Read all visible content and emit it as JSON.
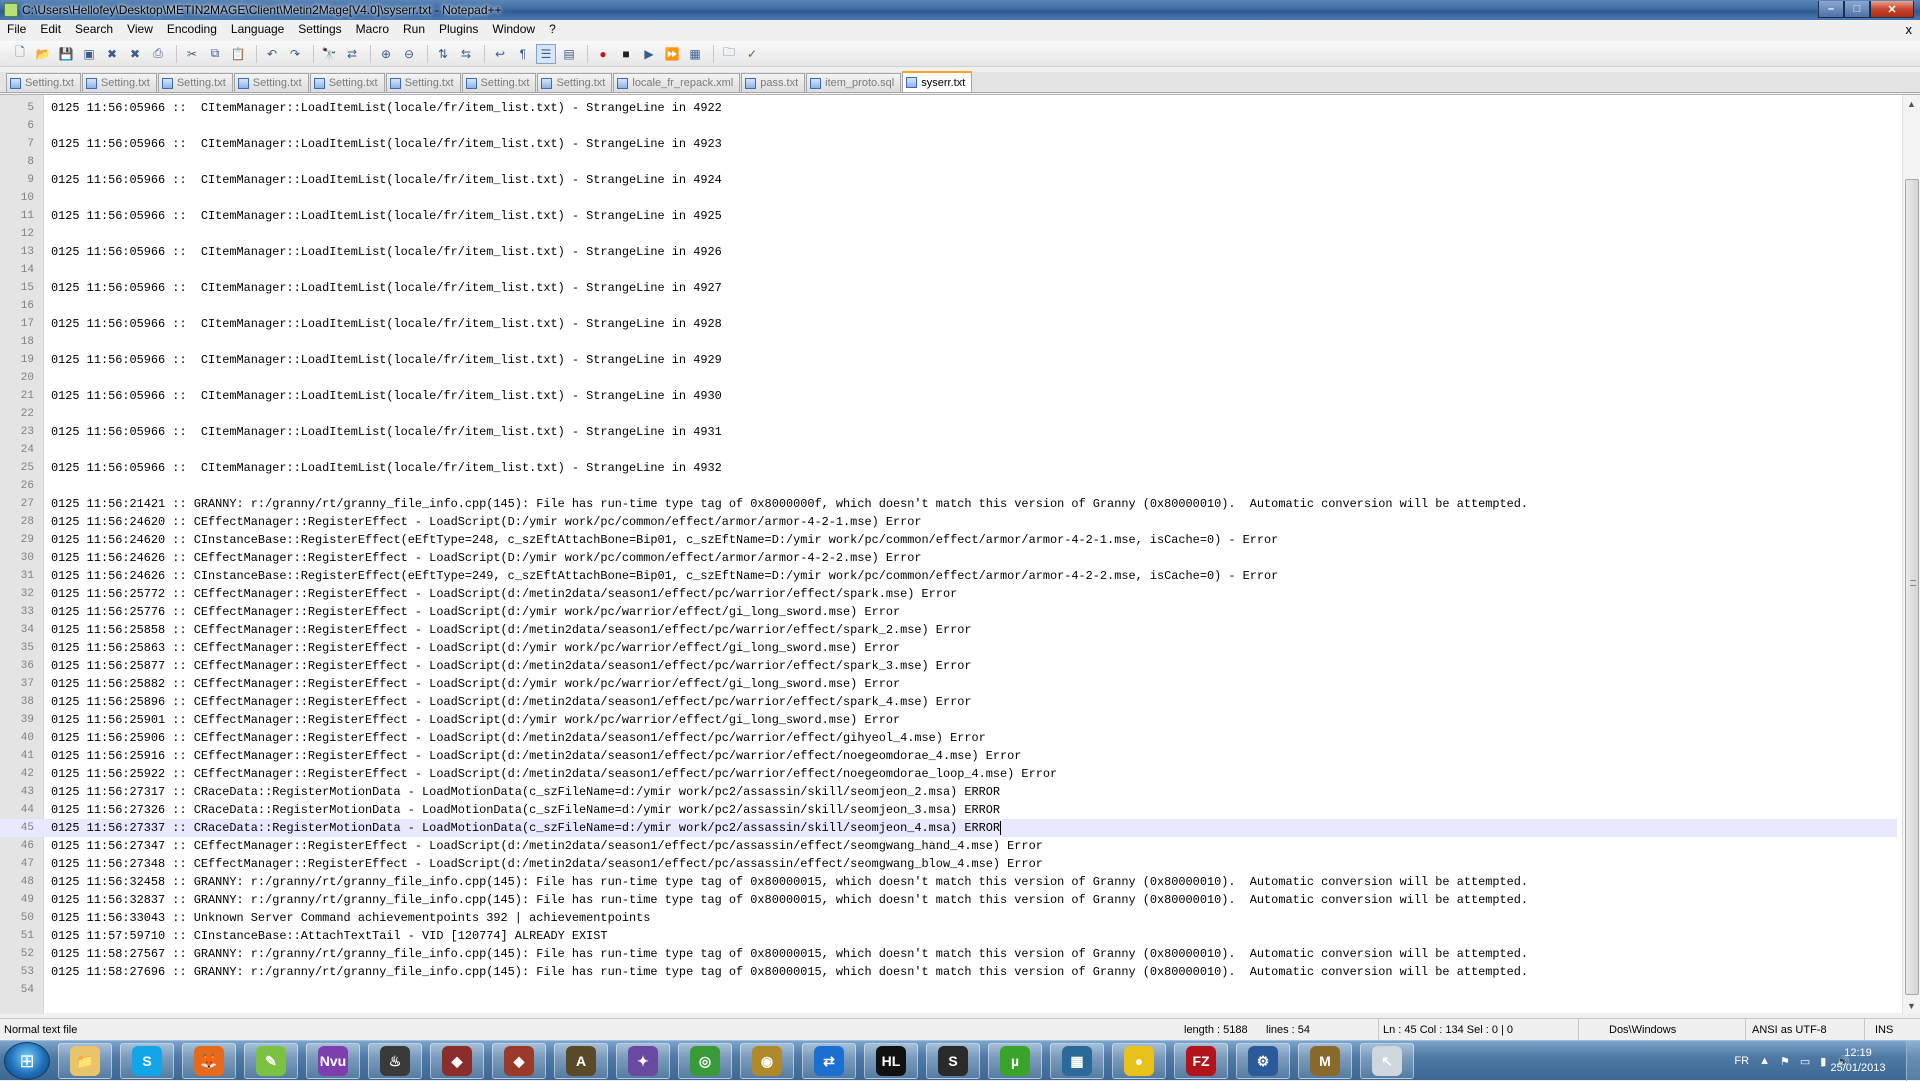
{
  "window": {
    "title": "C:\\Users\\Hellofey\\Desktop\\METIN2MAGE\\Client\\Metin2Mage[V4.0]\\syserr.txt - Notepad++",
    "min": "–",
    "max": "□",
    "close": "✕"
  },
  "menu": [
    "File",
    "Edit",
    "Search",
    "View",
    "Encoding",
    "Language",
    "Settings",
    "Macro",
    "Run",
    "Plugins",
    "Window",
    "?"
  ],
  "menu_close": "x",
  "tabs": [
    {
      "label": "Setting.txt",
      "active": false
    },
    {
      "label": "Setting.txt",
      "active": false
    },
    {
      "label": "Setting.txt",
      "active": false
    },
    {
      "label": "Setting.txt",
      "active": false
    },
    {
      "label": "Setting.txt",
      "active": false
    },
    {
      "label": "Setting.txt",
      "active": false
    },
    {
      "label": "Setting.txt",
      "active": false
    },
    {
      "label": "Setting.txt",
      "active": false
    },
    {
      "label": "locale_fr_repack.xml",
      "active": false
    },
    {
      "label": "pass.txt",
      "active": false
    },
    {
      "label": "item_proto.sql",
      "active": false
    },
    {
      "label": "syserr.txt",
      "active": true
    }
  ],
  "editor": {
    "current_line": 45,
    "lines": [
      {
        "n": "5",
        "t": "0125 11:56:05966 ::  CItemManager::LoadItemList(locale/fr/item_list.txt) - StrangeLine in 4922"
      },
      {
        "n": "6",
        "t": ""
      },
      {
        "n": "7",
        "t": "0125 11:56:05966 ::  CItemManager::LoadItemList(locale/fr/item_list.txt) - StrangeLine in 4923"
      },
      {
        "n": "8",
        "t": ""
      },
      {
        "n": "9",
        "t": "0125 11:56:05966 ::  CItemManager::LoadItemList(locale/fr/item_list.txt) - StrangeLine in 4924"
      },
      {
        "n": "10",
        "t": ""
      },
      {
        "n": "11",
        "t": "0125 11:56:05966 ::  CItemManager::LoadItemList(locale/fr/item_list.txt) - StrangeLine in 4925"
      },
      {
        "n": "12",
        "t": ""
      },
      {
        "n": "13",
        "t": "0125 11:56:05966 ::  CItemManager::LoadItemList(locale/fr/item_list.txt) - StrangeLine in 4926"
      },
      {
        "n": "14",
        "t": ""
      },
      {
        "n": "15",
        "t": "0125 11:56:05966 ::  CItemManager::LoadItemList(locale/fr/item_list.txt) - StrangeLine in 4927"
      },
      {
        "n": "16",
        "t": ""
      },
      {
        "n": "17",
        "t": "0125 11:56:05966 ::  CItemManager::LoadItemList(locale/fr/item_list.txt) - StrangeLine in 4928"
      },
      {
        "n": "18",
        "t": ""
      },
      {
        "n": "19",
        "t": "0125 11:56:05966 ::  CItemManager::LoadItemList(locale/fr/item_list.txt) - StrangeLine in 4929"
      },
      {
        "n": "20",
        "t": ""
      },
      {
        "n": "21",
        "t": "0125 11:56:05966 ::  CItemManager::LoadItemList(locale/fr/item_list.txt) - StrangeLine in 4930"
      },
      {
        "n": "22",
        "t": ""
      },
      {
        "n": "23",
        "t": "0125 11:56:05966 ::  CItemManager::LoadItemList(locale/fr/item_list.txt) - StrangeLine in 4931"
      },
      {
        "n": "24",
        "t": ""
      },
      {
        "n": "25",
        "t": "0125 11:56:05966 ::  CItemManager::LoadItemList(locale/fr/item_list.txt) - StrangeLine in 4932"
      },
      {
        "n": "26",
        "t": ""
      },
      {
        "n": "27",
        "t": "0125 11:56:21421 :: GRANNY: r:/granny/rt/granny_file_info.cpp(145): File has run-time type tag of 0x8000000f, which doesn't match this version of Granny (0x80000010).  Automatic conversion will be attempted."
      },
      {
        "n": "28",
        "t": "0125 11:56:24620 :: CEffectManager::RegisterEffect - LoadScript(D:/ymir work/pc/common/effect/armor/armor-4-2-1.mse) Error"
      },
      {
        "n": "29",
        "t": "0125 11:56:24620 :: CInstanceBase::RegisterEffect(eEftType=248, c_szEftAttachBone=Bip01, c_szEftName=D:/ymir work/pc/common/effect/armor/armor-4-2-1.mse, isCache=0) - Error"
      },
      {
        "n": "30",
        "t": "0125 11:56:24626 :: CEffectManager::RegisterEffect - LoadScript(D:/ymir work/pc/common/effect/armor/armor-4-2-2.mse) Error"
      },
      {
        "n": "31",
        "t": "0125 11:56:24626 :: CInstanceBase::RegisterEffect(eEftType=249, c_szEftAttachBone=Bip01, c_szEftName=D:/ymir work/pc/common/effect/armor/armor-4-2-2.mse, isCache=0) - Error"
      },
      {
        "n": "32",
        "t": "0125 11:56:25772 :: CEffectManager::RegisterEffect - LoadScript(d:/metin2data/season1/effect/pc/warrior/effect/spark.mse) Error"
      },
      {
        "n": "33",
        "t": "0125 11:56:25776 :: CEffectManager::RegisterEffect - LoadScript(d:/ymir work/pc/warrior/effect/gi_long_sword.mse) Error"
      },
      {
        "n": "34",
        "t": "0125 11:56:25858 :: CEffectManager::RegisterEffect - LoadScript(d:/metin2data/season1/effect/pc/warrior/effect/spark_2.mse) Error"
      },
      {
        "n": "35",
        "t": "0125 11:56:25863 :: CEffectManager::RegisterEffect - LoadScript(d:/ymir work/pc/warrior/effect/gi_long_sword.mse) Error"
      },
      {
        "n": "36",
        "t": "0125 11:56:25877 :: CEffectManager::RegisterEffect - LoadScript(d:/metin2data/season1/effect/pc/warrior/effect/spark_3.mse) Error"
      },
      {
        "n": "37",
        "t": "0125 11:56:25882 :: CEffectManager::RegisterEffect - LoadScript(d:/ymir work/pc/warrior/effect/gi_long_sword.mse) Error"
      },
      {
        "n": "38",
        "t": "0125 11:56:25896 :: CEffectManager::RegisterEffect - LoadScript(d:/metin2data/season1/effect/pc/warrior/effect/spark_4.mse) Error"
      },
      {
        "n": "39",
        "t": "0125 11:56:25901 :: CEffectManager::RegisterEffect - LoadScript(d:/ymir work/pc/warrior/effect/gi_long_sword.mse) Error"
      },
      {
        "n": "40",
        "t": "0125 11:56:25906 :: CEffectManager::RegisterEffect - LoadScript(d:/metin2data/season1/effect/pc/warrior/effect/gihyeol_4.mse) Error"
      },
      {
        "n": "41",
        "t": "0125 11:56:25916 :: CEffectManager::RegisterEffect - LoadScript(d:/metin2data/season1/effect/pc/warrior/effect/noegeomdorae_4.mse) Error"
      },
      {
        "n": "42",
        "t": "0125 11:56:25922 :: CEffectManager::RegisterEffect - LoadScript(d:/metin2data/season1/effect/pc/warrior/effect/noegeomdorae_loop_4.mse) Error"
      },
      {
        "n": "43",
        "t": "0125 11:56:27317 :: CRaceData::RegisterMotionData - LoadMotionData(c_szFileName=d:/ymir work/pc2/assassin/skill/seomjeon_2.msa) ERROR"
      },
      {
        "n": "44",
        "t": "0125 11:56:27326 :: CRaceData::RegisterMotionData - LoadMotionData(c_szFileName=d:/ymir work/pc2/assassin/skill/seomjeon_3.msa) ERROR"
      },
      {
        "n": "45",
        "t": "0125 11:56:27337 :: CRaceData::RegisterMotionData - LoadMotionData(c_szFileName=d:/ymir work/pc2/assassin/skill/seomjeon_4.msa) ERROR"
      },
      {
        "n": "46",
        "t": "0125 11:56:27347 :: CEffectManager::RegisterEffect - LoadScript(d:/metin2data/season1/effect/pc/assassin/effect/seomgwang_hand_4.mse) Error"
      },
      {
        "n": "47",
        "t": "0125 11:56:27348 :: CEffectManager::RegisterEffect - LoadScript(d:/metin2data/season1/effect/pc/assassin/effect/seomgwang_blow_4.mse) Error"
      },
      {
        "n": "48",
        "t": "0125 11:56:32458 :: GRANNY: r:/granny/rt/granny_file_info.cpp(145): File has run-time type tag of 0x80000015, which doesn't match this version of Granny (0x80000010).  Automatic conversion will be attempted."
      },
      {
        "n": "49",
        "t": "0125 11:56:32837 :: GRANNY: r:/granny/rt/granny_file_info.cpp(145): File has run-time type tag of 0x80000015, which doesn't match this version of Granny (0x80000010).  Automatic conversion will be attempted."
      },
      {
        "n": "50",
        "t": "0125 11:56:33043 :: Unknown Server Command achievementpoints 392 | achievementpoints"
      },
      {
        "n": "51",
        "t": "0125 11:57:59710 :: CInstanceBase::AttachTextTail - VID [120774] ALREADY EXIST"
      },
      {
        "n": "52",
        "t": "0125 11:58:27567 :: GRANNY: r:/granny/rt/granny_file_info.cpp(145): File has run-time type tag of 0x80000015, which doesn't match this version of Granny (0x80000010).  Automatic conversion will be attempted."
      },
      {
        "n": "53",
        "t": "0125 11:58:27696 :: GRANNY: r:/granny/rt/granny_file_info.cpp(145): File has run-time type tag of 0x80000015, which doesn't match this version of Granny (0x80000010).  Automatic conversion will be attempted."
      },
      {
        "n": "54",
        "t": ""
      }
    ]
  },
  "status": {
    "file_type": "Normal text file",
    "length": "length : 5188",
    "lines": "lines : 54",
    "position": "Ln : 45    Col : 134    Sel : 0 | 0",
    "eol": "Dos\\Windows",
    "encoding": "ANSI as UTF-8",
    "mode": "INS"
  },
  "taskbar": {
    "apps": [
      {
        "name": "explorer",
        "glyph": "📁",
        "color": "#e9c46a"
      },
      {
        "name": "skype",
        "glyph": "S",
        "color": "#12a5e8"
      },
      {
        "name": "firefox",
        "glyph": "🦊",
        "color": "#e66a1c"
      },
      {
        "name": "notepadpp",
        "glyph": "✎",
        "color": "#7cc242"
      },
      {
        "name": "nvu",
        "glyph": "Nvu",
        "color": "#7d3fb0"
      },
      {
        "name": "steam",
        "glyph": "♨",
        "color": "#3a3a3a"
      },
      {
        "name": "game1",
        "glyph": "◆",
        "color": "#8b2d2d"
      },
      {
        "name": "game2",
        "glyph": "◆",
        "color": "#9a3a2a"
      },
      {
        "name": "app-a",
        "glyph": "A",
        "color": "#5a4a2a"
      },
      {
        "name": "app-t",
        "glyph": "✦",
        "color": "#6a4aa0"
      },
      {
        "name": "chrome",
        "glyph": "◎",
        "color": "#3a9a3a"
      },
      {
        "name": "app-eye",
        "glyph": "◉",
        "color": "#b08a2a"
      },
      {
        "name": "teamviewer",
        "glyph": "⇄",
        "color": "#1a6fd0"
      },
      {
        "name": "hl",
        "glyph": "HL",
        "color": "#111111"
      },
      {
        "name": "app-s",
        "glyph": "S",
        "color": "#2a2a2a"
      },
      {
        "name": "utorrent",
        "glyph": "µ",
        "color": "#3aa32a"
      },
      {
        "name": "app-net",
        "glyph": "▦",
        "color": "#2a6a9a"
      },
      {
        "name": "app-lemon",
        "glyph": "●",
        "color": "#e8c21a"
      },
      {
        "name": "filezilla",
        "glyph": "FZ",
        "color": "#b3141b"
      },
      {
        "name": "app-python",
        "glyph": "⚙",
        "color": "#2a5a9a"
      },
      {
        "name": "app-m",
        "glyph": "M",
        "color": "#8a6a2a"
      },
      {
        "name": "app-cursor",
        "glyph": "↖",
        "color": "#cfd6de"
      }
    ],
    "lang": "FR",
    "time": "12:19",
    "date": "25/01/2013"
  }
}
